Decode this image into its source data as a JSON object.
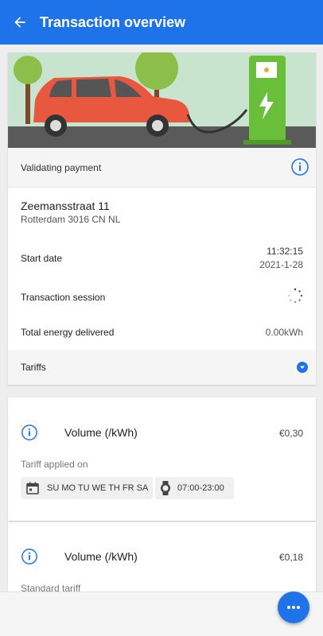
{
  "appbar": {
    "title": "Transaction overview",
    "back_icon": "arrow-left-icon"
  },
  "status": {
    "text": "Validating payment",
    "icon": "info-icon",
    "accent": "#1e73e8"
  },
  "location": {
    "street": "Zeemansstraat 11",
    "city": "Rotterdam 3016 CN NL"
  },
  "details": {
    "start_label": "Start date",
    "start_time": "11:32:15",
    "start_date": "2021-1-28",
    "session_label": "Transaction session",
    "energy_label": "Total energy delivered",
    "energy_value": "0.00kWh"
  },
  "tariffs": {
    "label": "Tariffs",
    "items": [
      {
        "name": "Volume (/kWh)",
        "price": "€0,30",
        "applied_label": "Tariff applied on",
        "days": "SU MO TU WE TH FR SA",
        "hours": "07:00-23:00"
      },
      {
        "name": "Volume (/kWh)",
        "price": "€0,18",
        "applied_label": "Standard tariff"
      }
    ]
  },
  "fab": {
    "icon": "more-horizontal-icon"
  }
}
